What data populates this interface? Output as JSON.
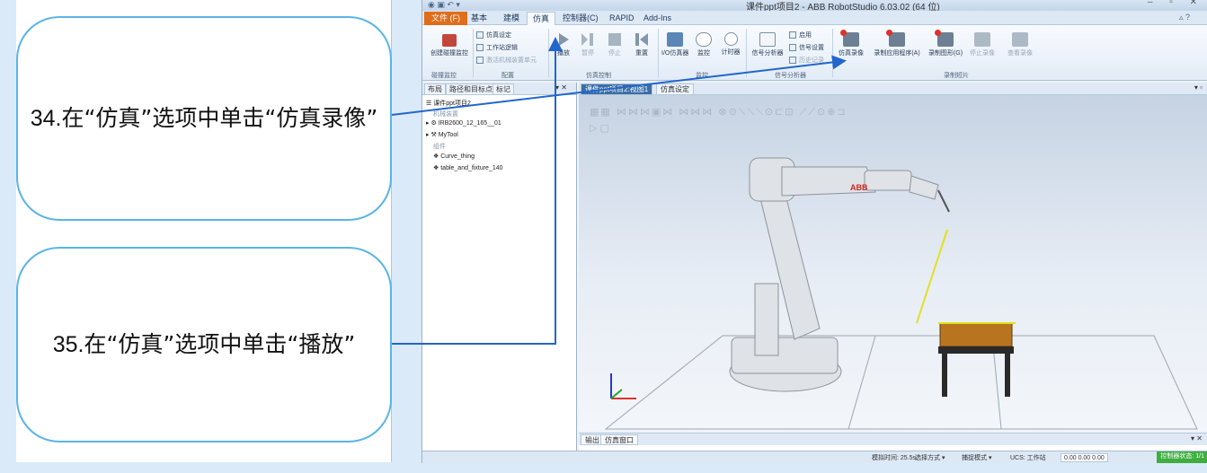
{
  "callouts": {
    "step34_num": "34.",
    "step34_text": "在“仿真”选项中单击“仿真录像”",
    "step35_num": "35.",
    "step35_text": "在“仿真”选项中单击“播放”"
  },
  "window": {
    "title": "课件ppt项目2 - ABB RobotStudio 6.03.02 (64 位)"
  },
  "menu": {
    "file": "文件 (F)",
    "tabs": [
      "基本",
      "建模",
      "仿真",
      "控制器(C)",
      "RAPID",
      "Add-Ins"
    ],
    "active_index": 2
  },
  "ribbon": {
    "collision": "创建碰撞监控",
    "sim_setup": "仿真设定",
    "station_logic": "工作站逻辑",
    "activate_unit": "激活机械装置单元",
    "play": "播放",
    "pause": "暂停",
    "stop": "停止",
    "reset": "重置",
    "io_sim": "I/O仿真器",
    "interrupt": "监控",
    "timer": "计时器",
    "signal_analyzer": "信号分析器",
    "enable": "启用",
    "signal_settings": "信号设置",
    "history": "历史记录",
    "sim_record": "仿真录像",
    "record_app": "录制应用程序(A)",
    "record_graphic": "录制图形(G)",
    "stop_record": "停止录像",
    "view_record": "查看录像",
    "groups": {
      "collision": "碰撞监控",
      "config": "配置",
      "sim_control": "仿真控制",
      "monitor": "监控",
      "signal_analyzer": "信号分析器",
      "record": "录制短片"
    }
  },
  "browser": {
    "tabs": [
      "布局",
      "路径和目标点",
      "标记"
    ],
    "station": "课件ppt项目2",
    "section_mech": "机械装置",
    "robot": "IRB2600_12_165__01",
    "tool": "MyTool",
    "section_parts": "组件",
    "part1": "Curve_thing",
    "part2": "table_and_fixture_140"
  },
  "view": {
    "tabs": [
      "课件ppt项目2:视图1",
      "仿真设定"
    ],
    "active_index": 0,
    "robot_brand": "ABB"
  },
  "output": {
    "tabs": [
      "输出",
      "仿真窗口"
    ]
  },
  "status": {
    "sim_time": "模拟时间: 25.5s",
    "select_mode": "选择方式 ▾",
    "snap_mode": "捕捉模式 ▾",
    "ucs": "UCS: 工作站",
    "coords": "0.00  0.00  0.00",
    "controller": "控制器状态: 1/1"
  }
}
